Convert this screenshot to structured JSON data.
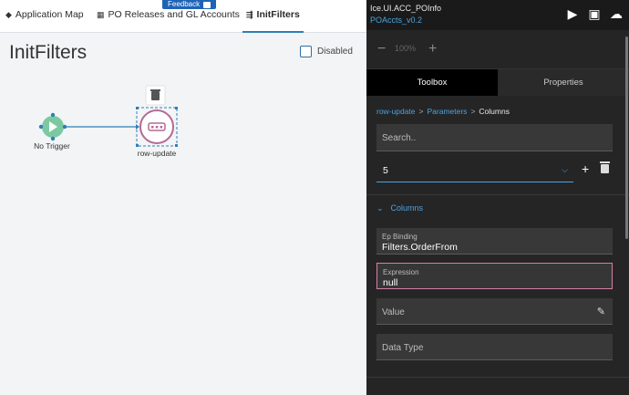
{
  "tabs": [
    {
      "label": "Application Map",
      "icon": "layers-icon"
    },
    {
      "label": "PO Releases and GL Accounts",
      "icon": "grid-icon"
    },
    {
      "label": "InitFilters",
      "icon": "flow-icon"
    }
  ],
  "feedback": {
    "label": "Feedback"
  },
  "canvas": {
    "title": "InitFilters",
    "disabled_label": "Disabled",
    "nodes": [
      {
        "label": "No Trigger"
      },
      {
        "label": "row-update"
      }
    ]
  },
  "panel": {
    "app_name": "Ice.UI.ACC_POInfo",
    "app_version": "POAccts_v0.2",
    "zoom": "100%",
    "tabs": [
      "Toolbox",
      "Properties"
    ],
    "breadcrumb": [
      "row-update",
      "Parameters",
      "Columns"
    ],
    "search_placeholder": "Search..",
    "selected_value": "5",
    "section_title": "Columns",
    "ep_binding": {
      "label": "Ep Binding",
      "value": "Filters.OrderFrom"
    },
    "expression": {
      "label": "Expression",
      "value": "null"
    },
    "value_placeholder": "Value",
    "data_type_placeholder": "Data Type"
  },
  "colors": {
    "accent": "#4aa3e0",
    "node_start": "#7cc9a1",
    "node_action": "#b56a93",
    "selection": "#2d7fb8"
  }
}
